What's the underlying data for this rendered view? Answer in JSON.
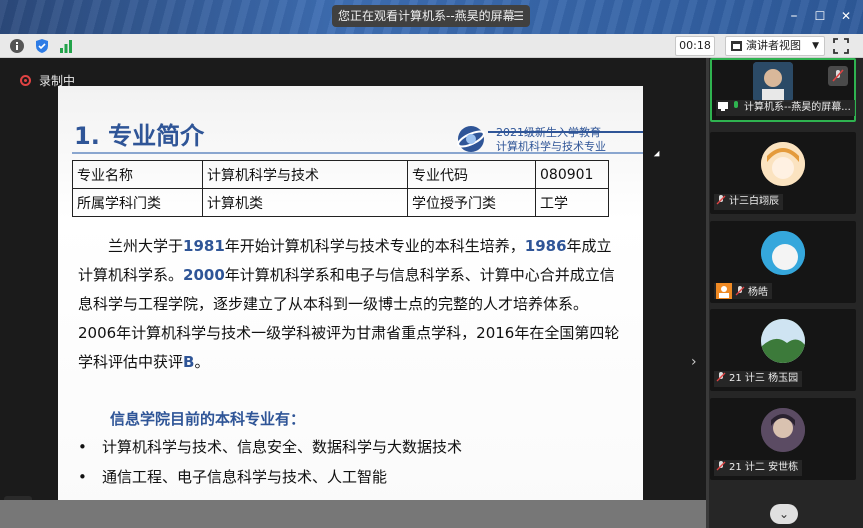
{
  "window": {
    "title": "您正在观看计算机系--燕昊的屏幕",
    "minimize": "–",
    "maximize": "☐",
    "close": "✕"
  },
  "toolbar": {
    "timer": "00:18",
    "presenter_view": "演讲者视图"
  },
  "recording": {
    "label": "录制中"
  },
  "slide": {
    "title": "1. 专业简介",
    "logo_text_line1": "2021级新生入学教育",
    "logo_text_line2": "计算机科学与技术专业",
    "table": [
      [
        "专业名称",
        "计算机科学与技术",
        "专业代码",
        "080901"
      ],
      [
        "所属学科门类",
        "计算机类",
        "学位授予门类",
        "工学"
      ]
    ],
    "para": {
      "p1": "兰州大学于",
      "h1": "1981",
      "p2": "年开始计算机科学与技术专业的本科生培养，",
      "h2": "1986",
      "p3": "年成立计算机科学系。",
      "h3": "2000",
      "p4": "年计算机科学系和电子与信息科学系、计算中心合并成立信息科学与工程学院，逐步建立了从本科到一级博士点的完整的人才培养体系。2006年计算机科学与技术一级学科被评为甘肃省重点学科，2016年在全国第四轮学科评估中获评",
      "h4": "B",
      "p5": "。"
    },
    "subheading": "信息学院目前的本科专业有：",
    "bullets": [
      "计算机科学与技术、信息安全、数据科学与大数据技术",
      "通信工程、电子信息科学与技术、人工智能"
    ]
  },
  "participants": [
    {
      "name": "计算机系--燕昊的屏幕...",
      "active": true
    },
    {
      "name": "计三白翊辰",
      "active": false
    },
    {
      "name": "杨皓",
      "active": false
    },
    {
      "name": "21 计三 杨玉园",
      "active": false
    },
    {
      "name": "21 计二 安世栋",
      "active": false
    }
  ],
  "colors": {
    "accent": "#2f5597",
    "active_border": "#2fb350",
    "record_red": "#e04343"
  }
}
